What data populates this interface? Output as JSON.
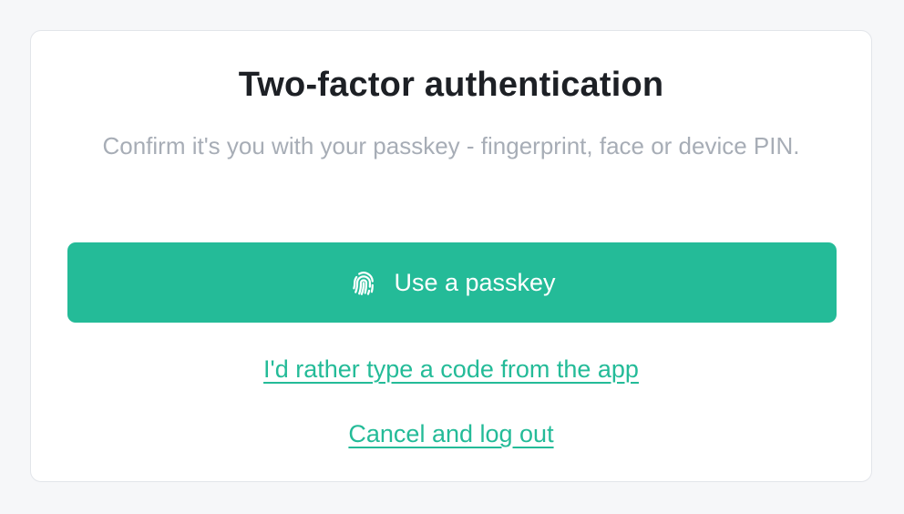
{
  "auth": {
    "title": "Two-factor authentication",
    "subtitle": "Confirm it's you with your passkey - fingerprint, face or device PIN.",
    "passkey_button_label": "Use a passkey",
    "passkey_icon": "fingerprint-icon",
    "type_code_link": "I'd rather type a code from the app",
    "cancel_link": "Cancel and log out"
  },
  "colors": {
    "accent": "#24bb98",
    "title": "#1d2025",
    "subtitle": "#a7adb6",
    "background": "#f6f7f9",
    "card": "#ffffff"
  }
}
